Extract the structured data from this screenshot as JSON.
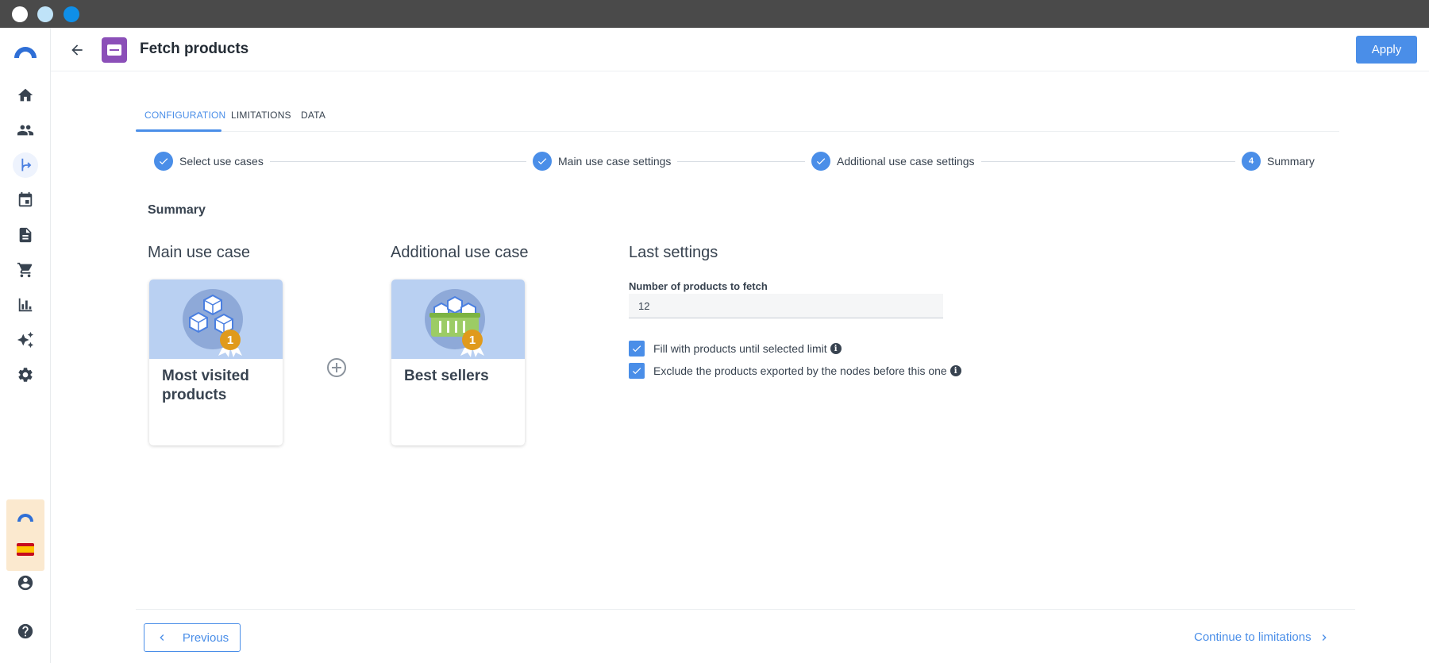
{
  "header": {
    "title": "Fetch products",
    "apply_label": "Apply"
  },
  "tabs": [
    {
      "label": "CONFIGURATION",
      "active": true
    },
    {
      "label": "LIMITATIONS",
      "active": false
    },
    {
      "label": "DATA",
      "active": false
    }
  ],
  "stepper": [
    {
      "label": "Select use cases",
      "state": "done"
    },
    {
      "label": "Main use case settings",
      "state": "done"
    },
    {
      "label": "Additional use case settings",
      "state": "done"
    },
    {
      "label": "Summary",
      "state": "current",
      "number": "4"
    }
  ],
  "summary": {
    "heading": "Summary",
    "main_title": "Main use case",
    "additional_title": "Additional use case",
    "last_title": "Last settings",
    "main_card": {
      "name": "Most visited products",
      "badge": "1"
    },
    "additional_card": {
      "name": "Best sellers",
      "badge": "1"
    },
    "fields": {
      "num_label": "Number of products to fetch",
      "num_value": "12"
    },
    "checkboxes": [
      {
        "label": "Fill with products until selected limit",
        "checked": true
      },
      {
        "label": "Exclude the products exported by the nodes before this one",
        "checked": true
      }
    ]
  },
  "footer": {
    "previous_label": "Previous",
    "next_label": "Continue to limitations"
  },
  "sidebar": {
    "items": [
      "home-icon",
      "people-icon",
      "flow-icon",
      "calendar-icon",
      "document-icon",
      "cart-icon",
      "chart-icon",
      "sparkle-icon",
      "gear-icon"
    ],
    "active": "flow-icon"
  },
  "colors": {
    "accent": "#4a8ee8",
    "card_image_bg": "#b9d0f2",
    "node_icon": "#8b4fb8",
    "brand_bg": "#fbe9cf"
  }
}
